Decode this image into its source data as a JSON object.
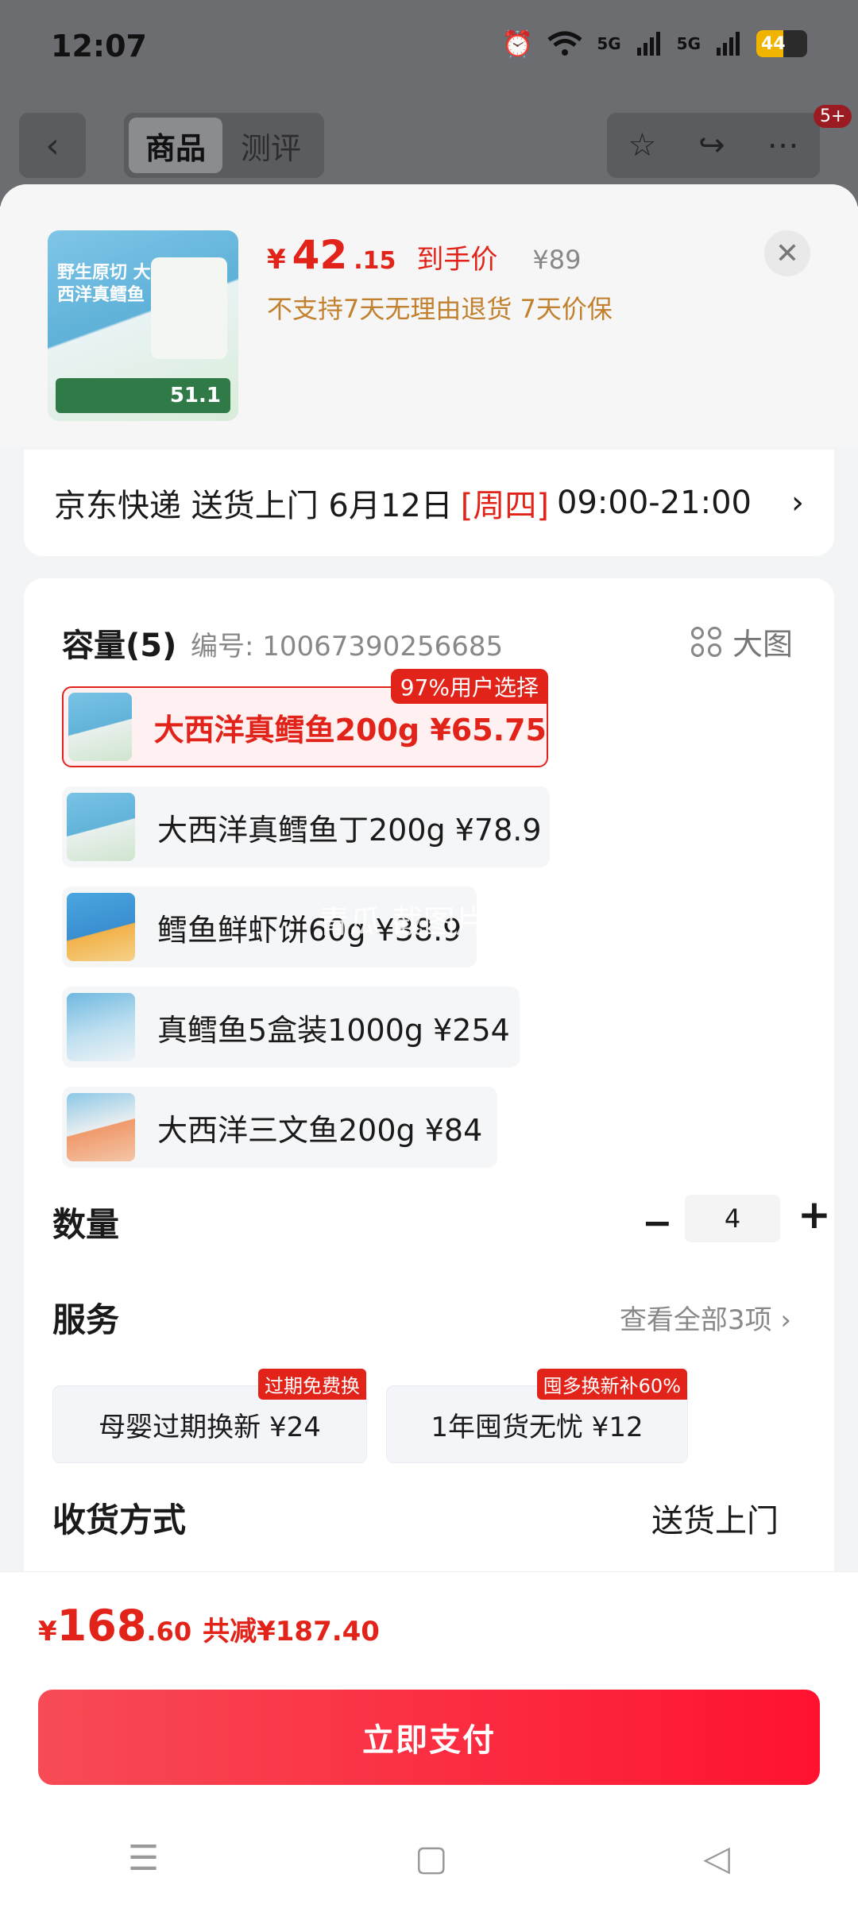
{
  "status_bar": {
    "time": "12:07",
    "net1": "5G",
    "net2": "5G",
    "battery": "44"
  },
  "nav": {
    "back": "‹",
    "tabs": [
      "商品",
      "测评"
    ],
    "badge": "5+"
  },
  "product": {
    "currency": "¥",
    "price_int": "42",
    "price_dec": ".15",
    "price_tag": "到手价",
    "original_price": "¥89",
    "policy": "不支持7天无理由退货  7天价保",
    "thumb_title": "野生原切 大西洋真鳕鱼",
    "thumb_price": "51.1"
  },
  "delivery": {
    "text": "京东快递 送货上门 6月12日",
    "weekday": "[周四]",
    "time": "09:00-21:00"
  },
  "capacity": {
    "title": "容量(5)",
    "code": "编号: 10067390256685",
    "big_image": "大图",
    "badge": "97%用户选择",
    "options": [
      {
        "label": "大西洋真鳕鱼200g  ¥65.75",
        "selected": true
      },
      {
        "label": "大西洋真鳕鱼丁200g  ¥78.9",
        "selected": false
      },
      {
        "label": "鳕鱼鲜虾饼60g  ¥38.9",
        "selected": false
      },
      {
        "label": "真鳕鱼5盒装1000g  ¥254",
        "selected": false
      },
      {
        "label": "大西洋三文鱼200g  ¥84",
        "selected": false
      }
    ],
    "watermark": "青瓜 截图片"
  },
  "quantity": {
    "label": "数量",
    "value": "4",
    "minus": "−",
    "plus": "+"
  },
  "service": {
    "label": "服务",
    "view_all": "查看全部3项",
    "items": [
      {
        "label": "母婴过期换新  ¥24",
        "tag": "过期免费换"
      },
      {
        "label": "1年囤货无忧  ¥12",
        "tag": "囤多换新补60%"
      }
    ]
  },
  "receive": {
    "label": "收货方式",
    "value": "送货上门"
  },
  "pay": {
    "currency": "¥",
    "int": "168",
    "dec": ".60",
    "saving": "共减¥187.40",
    "button": "立即支付"
  },
  "colors": {
    "accent": "#e2231a",
    "pay_button": "#ff1230",
    "policy": "#c2812e"
  }
}
